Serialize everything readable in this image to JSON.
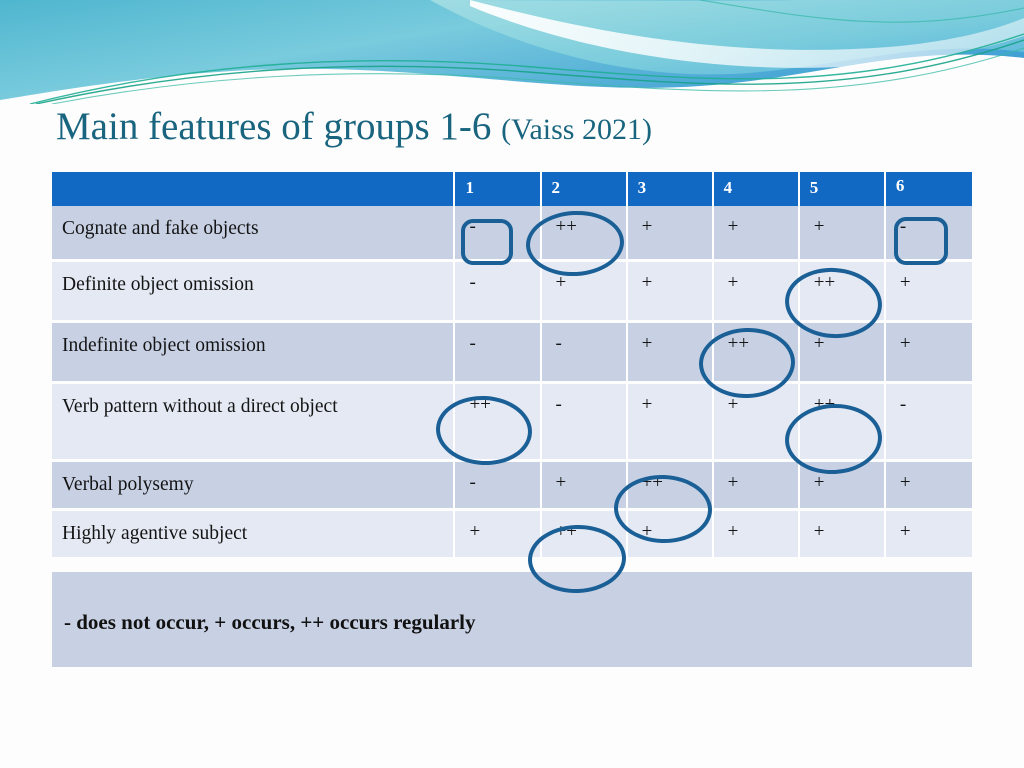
{
  "slide": {
    "title_main": "Main features of groups 1-6",
    "title_citation": "(Vaiss 2021)",
    "title_color": "#19647e",
    "accent_header_color": "#1269c4",
    "row_dark_color": "#c8d1e4",
    "row_light_color": "#e4e9f4",
    "annotation_color": "#1a5f96"
  },
  "table": {
    "corner_header": "",
    "column_headers": [
      "1",
      "2",
      "3",
      "4",
      "5",
      "6"
    ],
    "rows": [
      {
        "label": "Cognate and fake objects",
        "values": [
          "-",
          "++",
          "+",
          "+",
          "+",
          "-"
        ]
      },
      {
        "label": "Definite object omission",
        "values": [
          "-",
          "+",
          "+",
          "+",
          "++",
          "+"
        ]
      },
      {
        "label": "Indefinite object omission",
        "values": [
          "-",
          "-",
          "+",
          "++",
          "+",
          "+"
        ]
      },
      {
        "label": "Verb pattern without a direct object",
        "values": [
          "++",
          "-",
          "+",
          "+",
          "++",
          "-"
        ]
      },
      {
        "label": "Verbal polysemy",
        "values": [
          "-",
          "+",
          "++",
          "+",
          "+",
          "+"
        ]
      },
      {
        "label": "Highly agentive subject",
        "values": [
          "+",
          "++",
          "+",
          "+",
          "+",
          "+"
        ]
      }
    ]
  },
  "legend": {
    "text": "- does not occur, + occurs, ++ occurs regularly"
  },
  "annotations": [
    {
      "shape": "box",
      "row": 1,
      "column": 1,
      "value": "-"
    },
    {
      "shape": "ellipse",
      "row": 1,
      "column": 2,
      "value": "++"
    },
    {
      "shape": "box",
      "row": 1,
      "column": 6,
      "value": "-"
    },
    {
      "shape": "ellipse",
      "row": 2,
      "column": 5,
      "value": "++"
    },
    {
      "shape": "ellipse",
      "row": 3,
      "column": 4,
      "value": "++"
    },
    {
      "shape": "ellipse",
      "row": 4,
      "column": 1,
      "value": "++"
    },
    {
      "shape": "ellipse",
      "row": 4,
      "column": 5,
      "value": "++"
    },
    {
      "shape": "ellipse",
      "row": 5,
      "column": 3,
      "value": "++"
    },
    {
      "shape": "ellipse",
      "row": 6,
      "column": 2,
      "value": "++"
    }
  ]
}
